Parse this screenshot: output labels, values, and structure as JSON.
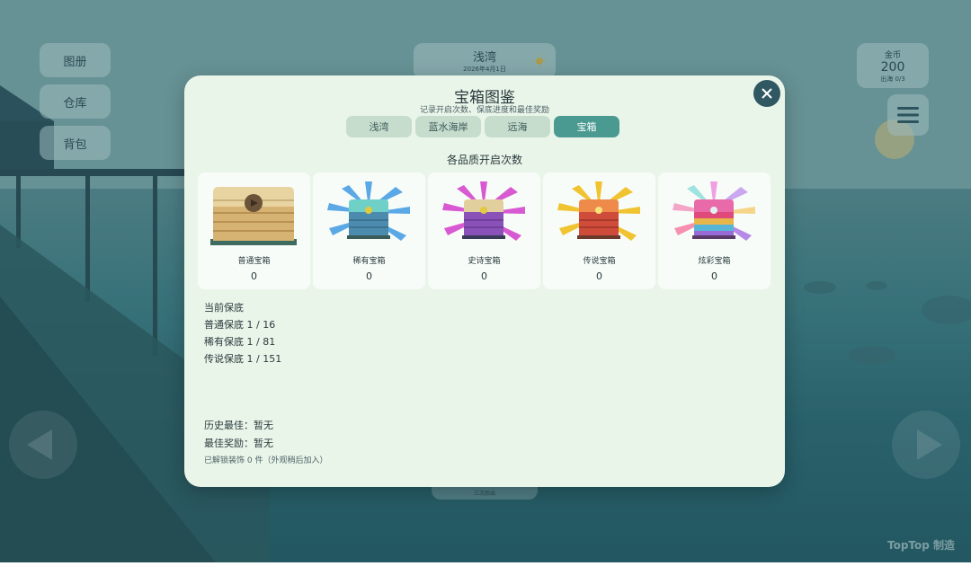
{
  "hud": {
    "left_buttons": [
      "图册",
      "仓库",
      "背包"
    ],
    "location": {
      "name": "浅湾",
      "date": "2026年4月1日"
    },
    "coins": {
      "label": "金币",
      "value": "200",
      "sub": "出海 0/3"
    },
    "bottom_button_small": "三次后出"
  },
  "modal": {
    "title": "宝箱图鉴",
    "subtitle": "记录开启次数、保底进度和最佳奖励",
    "tabs": [
      {
        "label": "浅湾",
        "active": false
      },
      {
        "label": "蓝水海岸",
        "active": false
      },
      {
        "label": "远海",
        "active": false
      },
      {
        "label": "宝箱",
        "active": true
      }
    ],
    "section_title": "各品质开启次数",
    "chests": [
      {
        "name": "普通宝箱",
        "count": "0"
      },
      {
        "name": "稀有宝箱",
        "count": "0"
      },
      {
        "name": "史诗宝箱",
        "count": "0"
      },
      {
        "name": "传说宝箱",
        "count": "0"
      },
      {
        "name": "炫彩宝箱",
        "count": "0"
      }
    ],
    "pity_title": "当前保底",
    "pity": [
      "普通保底 1 / 16",
      "稀有保底 1 / 81",
      "传说保底 1 / 151"
    ],
    "best_history": "历史最佳：暂无",
    "best_reward": "最佳奖励：暂无",
    "unlocked": "已解锁装饰 0 件（外观稍后加入）"
  },
  "watermark": "TopTop 制造",
  "colors": {
    "accent": "#4a9a92",
    "close": "#2f5863",
    "modal_bg": "#eaf5ea"
  }
}
